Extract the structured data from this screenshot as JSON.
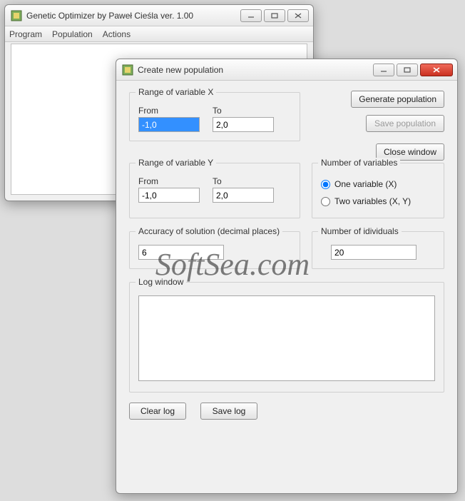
{
  "main_window": {
    "title": "Genetic Optimizer by Paweł Cieśla ver. 1.00",
    "menu": {
      "items": [
        "Program",
        "Population",
        "Actions"
      ]
    }
  },
  "dialog": {
    "title": "Create new population",
    "range_x": {
      "legend": "Range of variable X",
      "from_label": "From",
      "to_label": "To",
      "from": "-1,0",
      "to": "2,0"
    },
    "range_y": {
      "legend": "Range of variable Y",
      "from_label": "From",
      "to_label": "To",
      "from": "-1,0",
      "to": "2,0"
    },
    "buttons": {
      "generate": "Generate population",
      "save_pop": "Save population",
      "close": "Close window",
      "clear_log": "Clear log",
      "save_log": "Save log"
    },
    "num_vars": {
      "legend": "Number of variables",
      "opt1": "One variable (X)",
      "opt2": "Two variables (X, Y)",
      "selected": "one"
    },
    "accuracy": {
      "legend": "Accuracy of solution (decimal places)",
      "value": "6"
    },
    "individuals": {
      "legend": "Number of idividuals",
      "value": "20"
    },
    "log": {
      "legend": "Log window",
      "content": ""
    }
  },
  "watermark": "SoftSea.com"
}
